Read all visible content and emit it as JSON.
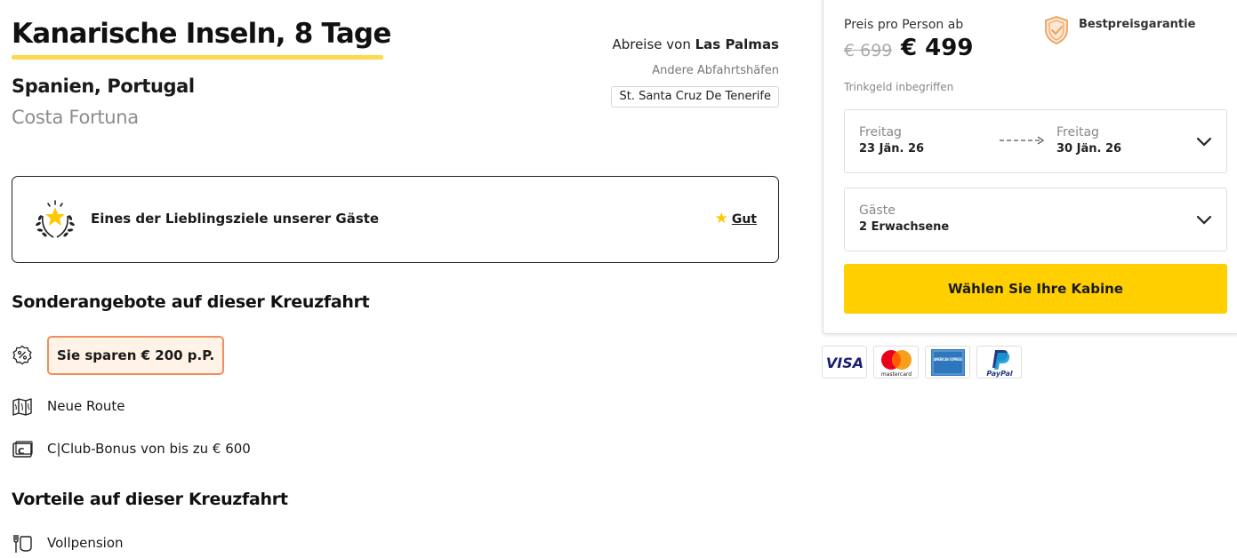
{
  "header": {
    "title": "Kanarische Inseln, 8 Tage",
    "countries": "Spanien, Portugal",
    "ship": "Costa Fortuna"
  },
  "departure": {
    "prefix": "Abreise von",
    "port": "Las Palmas",
    "other_label": "Andere Abfahrtshäfen",
    "other_port": "St. Santa Cruz De Tenerife"
  },
  "favorite": {
    "text": "Eines der Lieblingsziele unserer Gäste",
    "rating": "Gut"
  },
  "offers": {
    "heading": "Sonderangebote auf dieser Kreuzfahrt",
    "items": [
      {
        "icon": "percent-badge-icon",
        "text": "Sie sparen € 200 p.P."
      },
      {
        "icon": "map-icon",
        "text": "Neue Route"
      },
      {
        "icon": "cclub-icon",
        "text": "C|Club-Bonus von bis zu € 600"
      }
    ]
  },
  "benefits": {
    "heading": "Vorteile auf dieser Kreuzfahrt",
    "items": [
      {
        "icon": "fork-plate-icon",
        "text": "Vollpension"
      }
    ]
  },
  "booking": {
    "price_label": "Preis pro Person ab",
    "old_price": "€ 699",
    "new_price": "€ 499",
    "guarantee": "Bestpreisgarantie",
    "tip_note": "Trinkgeld inbegriffen",
    "date_from_day": "Freitag",
    "date_from": "23 Jän. 26",
    "date_to_day": "Freitag",
    "date_to": "30 Jän. 26",
    "guests_label": "Gäste",
    "guests_value": "2 Erwachsene",
    "cta": "Wählen Sie Ihre Kabine"
  },
  "payment_methods": [
    "VISA",
    "mastercard",
    "AMERICAN EXPRESS",
    "PayPal"
  ],
  "colors": {
    "accent_yellow": "#ffcf00",
    "savings_border": "#f08f5e",
    "savings_bg": "#fff3e8",
    "guarantee_orange": "#f0a05c"
  }
}
